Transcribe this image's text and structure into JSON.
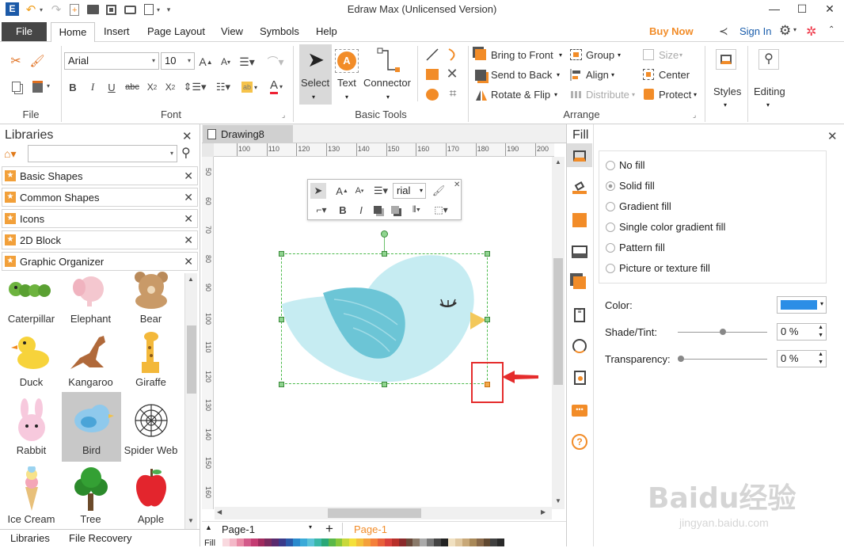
{
  "app": {
    "title": "Edraw Max (Unlicensed Version)"
  },
  "menu": {
    "file": "File",
    "tabs": [
      "Home",
      "Insert",
      "Page Layout",
      "View",
      "Symbols",
      "Help"
    ],
    "buy_now": "Buy Now",
    "sign_in": "Sign In"
  },
  "ribbon": {
    "file_group": "File",
    "font_group": "Font",
    "font_name": "Arial",
    "font_size": "10",
    "basic_tools_group": "Basic Tools",
    "select": "Select",
    "text": "Text",
    "connector": "Connector",
    "arrange_group": "Arrange",
    "bring_to_front": "Bring to Front",
    "send_to_back": "Send to Back",
    "rotate_flip": "Rotate & Flip",
    "group": "Group",
    "align": "Align",
    "distribute": "Distribute",
    "size": "Size",
    "center": "Center",
    "protect": "Protect",
    "styles": "Styles",
    "editing": "Editing"
  },
  "libraries": {
    "title": "Libraries",
    "categories": [
      "Basic Shapes",
      "Common Shapes",
      "Icons",
      "2D Block",
      "Graphic Organizer"
    ],
    "shapes": [
      "Caterpillar",
      "Elephant",
      "Bear",
      "Duck",
      "Kangaroo",
      "Giraffe",
      "Rabbit",
      "Bird",
      "Spider Web",
      "Ice Cream",
      "Tree",
      "Apple"
    ],
    "bottom_tabs": [
      "Libraries",
      "File Recovery"
    ]
  },
  "document": {
    "tab": "Drawing8",
    "page_select": "Page-1",
    "page_tab": "Page-1",
    "fill_label": "Fill"
  },
  "float_toolbar": {
    "font": "rial"
  },
  "ruler": {
    "h": [
      "100",
      "110",
      "120",
      "130",
      "140",
      "150",
      "160",
      "170",
      "180",
      "190",
      "200"
    ],
    "v": [
      "50",
      "60",
      "70",
      "80",
      "90",
      "100",
      "110",
      "120",
      "130",
      "140",
      "150",
      "160"
    ]
  },
  "fill_panel": {
    "title": "Fill",
    "options": [
      "No fill",
      "Solid fill",
      "Gradient fill",
      "Single color gradient fill",
      "Pattern fill",
      "Picture or texture fill"
    ],
    "selected": "Solid fill",
    "color_label": "Color:",
    "color_value": "#2b8ee6",
    "shade_label": "Shade/Tint:",
    "shade_value": "0 %",
    "transparency_label": "Transparency:",
    "transparency_value": "0 %"
  },
  "watermark": {
    "brand": "Baidu经验",
    "url": "jingyan.baidu.com"
  },
  "colors": {
    "accent": "#f28c28",
    "link": "#1a5dab",
    "bird": "#c6ecf2",
    "wing": "#6cc5d6"
  }
}
